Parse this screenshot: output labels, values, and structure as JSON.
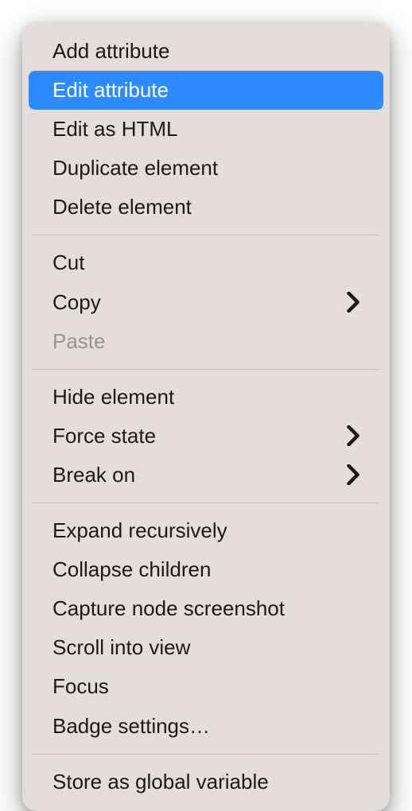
{
  "menu": {
    "groups": [
      {
        "items": [
          {
            "id": "add-attribute",
            "label": "Add attribute",
            "submenu": false,
            "disabled": false,
            "highlighted": false
          },
          {
            "id": "edit-attribute",
            "label": "Edit attribute",
            "submenu": false,
            "disabled": false,
            "highlighted": true
          },
          {
            "id": "edit-as-html",
            "label": "Edit as HTML",
            "submenu": false,
            "disabled": false,
            "highlighted": false
          },
          {
            "id": "duplicate-element",
            "label": "Duplicate element",
            "submenu": false,
            "disabled": false,
            "highlighted": false
          },
          {
            "id": "delete-element",
            "label": "Delete element",
            "submenu": false,
            "disabled": false,
            "highlighted": false
          }
        ]
      },
      {
        "items": [
          {
            "id": "cut",
            "label": "Cut",
            "submenu": false,
            "disabled": false,
            "highlighted": false
          },
          {
            "id": "copy",
            "label": "Copy",
            "submenu": true,
            "disabled": false,
            "highlighted": false
          },
          {
            "id": "paste",
            "label": "Paste",
            "submenu": false,
            "disabled": true,
            "highlighted": false
          }
        ]
      },
      {
        "items": [
          {
            "id": "hide-element",
            "label": "Hide element",
            "submenu": false,
            "disabled": false,
            "highlighted": false
          },
          {
            "id": "force-state",
            "label": "Force state",
            "submenu": true,
            "disabled": false,
            "highlighted": false
          },
          {
            "id": "break-on",
            "label": "Break on",
            "submenu": true,
            "disabled": false,
            "highlighted": false
          }
        ]
      },
      {
        "items": [
          {
            "id": "expand-recursively",
            "label": "Expand recursively",
            "submenu": false,
            "disabled": false,
            "highlighted": false
          },
          {
            "id": "collapse-children",
            "label": "Collapse children",
            "submenu": false,
            "disabled": false,
            "highlighted": false
          },
          {
            "id": "capture-node-screenshot",
            "label": "Capture node screenshot",
            "submenu": false,
            "disabled": false,
            "highlighted": false
          },
          {
            "id": "scroll-into-view",
            "label": "Scroll into view",
            "submenu": false,
            "disabled": false,
            "highlighted": false
          },
          {
            "id": "focus",
            "label": "Focus",
            "submenu": false,
            "disabled": false,
            "highlighted": false
          },
          {
            "id": "badge-settings",
            "label": "Badge settings…",
            "submenu": false,
            "disabled": false,
            "highlighted": false
          }
        ]
      },
      {
        "items": [
          {
            "id": "store-as-global-variable",
            "label": "Store as global variable",
            "submenu": false,
            "disabled": false,
            "highlighted": false
          }
        ]
      }
    ]
  }
}
